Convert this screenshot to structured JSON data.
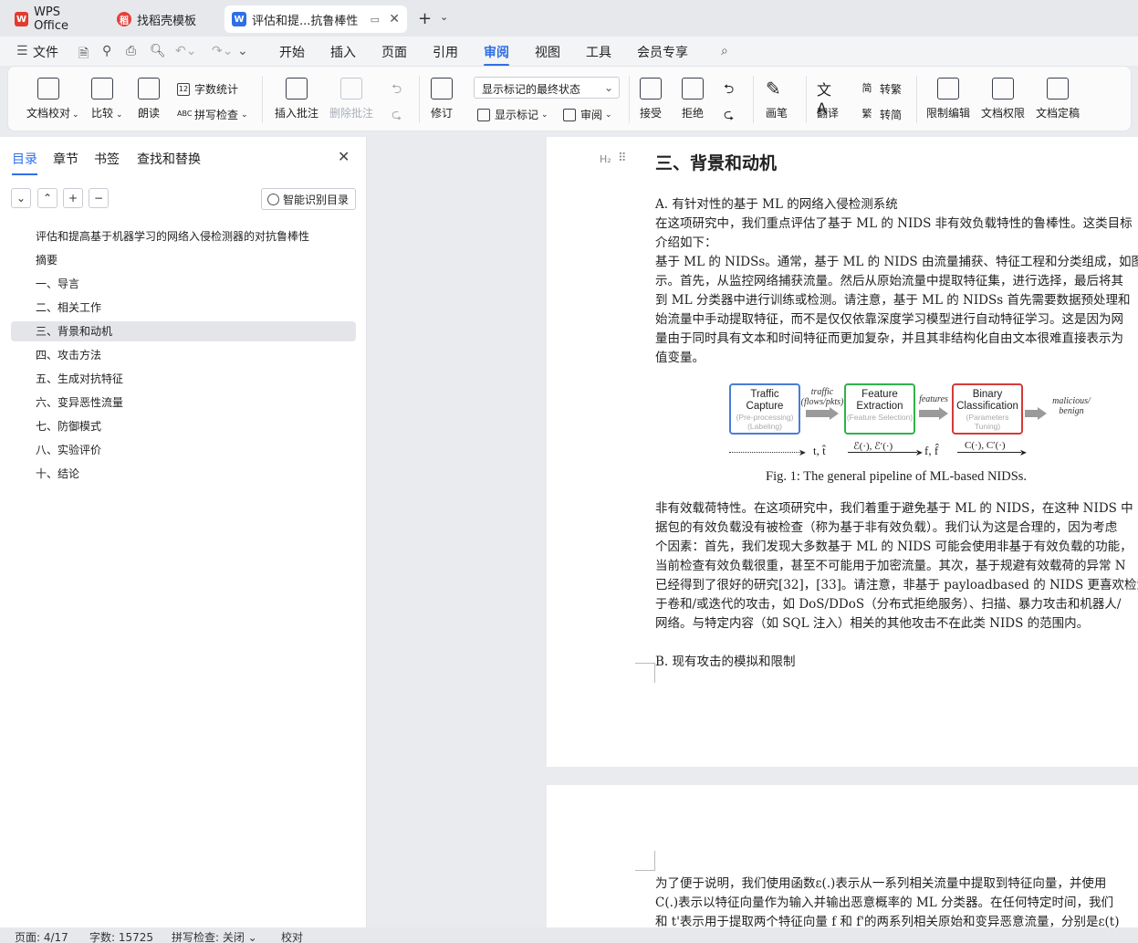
{
  "titlebar": {
    "tabs": [
      {
        "label": "WPS Office",
        "icon": "wps-logo-icon"
      },
      {
        "label": "找稻壳模板",
        "icon": "docer-icon"
      },
      {
        "label": "评估和提...抗鲁棒性",
        "icon": "word-doc-icon"
      }
    ]
  },
  "menubar": {
    "file": "文件",
    "items": [
      "开始",
      "插入",
      "页面",
      "引用",
      "审阅",
      "视图",
      "工具",
      "会员专享"
    ],
    "active": "审阅"
  },
  "ribbon": {
    "proofread": "文档校对",
    "compare": "比较",
    "read_aloud": "朗读",
    "word_count": "字数统计",
    "spell_check": "拼写检查",
    "insert_comment": "插入批注",
    "delete_comment": "删除批注",
    "revise": "修订",
    "markup_state": "显示标记的最终状态",
    "show_markup": "显示标记",
    "review": "审阅",
    "accept": "接受",
    "reject": "拒绝",
    "pen": "画笔",
    "translate": "翻译",
    "to_traditional": "转繁",
    "to_simplified": "转简",
    "restrict_edit": "限制编辑",
    "doc_permission": "文档权限",
    "doc_finalize": "文档定稿"
  },
  "sidebar": {
    "tabs": [
      "目录",
      "章节",
      "书签",
      "查找和替换"
    ],
    "smart_toc": "智能识别目录",
    "toc": [
      "评估和提高基于机器学习的网络入侵检测器的对抗鲁棒性",
      "摘要",
      "一、导言",
      "二、相关工作",
      "三、背景和动机",
      "四、攻击方法",
      "五、生成对抗特征",
      "六、变异恶性流量",
      "七、防御模式",
      "八、实验评价",
      "十、结论"
    ],
    "selected_index": 4
  },
  "document": {
    "heading": "三、背景和动机",
    "subA": "A. 有针对性的基于 ML 的网络入侵检测系统",
    "para1": [
      "在这项研究中，我们重点评估了基于 ML 的 NIDS 非有效负载特性的鲁棒性。这类目标",
      "介绍如下：",
      "基于 ML 的 NIDSs。通常，基于 ML 的 NIDS 由流量捕获、特征工程和分类组成，如图",
      "示。首先，从监控网络捕获流量。然后从原始流量中提取特征集，进行选择，最后将其",
      "到 ML 分类器中进行训练或检测。请注意，基于 ML 的 NIDSs 首先需要数据预处理和",
      "始流量中手动提取特征，而不是仅仅依靠深度学习模型进行自动特征学习。这是因为网",
      "量由于同时具有文本和时间特征而更加复杂，并且其非结构化自由文本很难直接表示为",
      "值变量。"
    ],
    "figure": {
      "box1": {
        "title": "Traffic Capture",
        "sub": "(Pre-processing) (Labeling)"
      },
      "box2": {
        "title": "Feature Extraction",
        "sub": "(Feature Selection)"
      },
      "box3": {
        "title": "Binary Classification",
        "sub": "(Parameters Tuning)"
      },
      "arrow1": "traffic (flows/pkts)",
      "arrow2": "features",
      "arrow3": "malicious/ benign",
      "m1": "t, t̂",
      "m2": "ℰ(·), ℰ′(·)",
      "m3": "f, f̂",
      "m4": "C(·), C′(·)",
      "caption": "Fig. 1: The general pipeline of ML-based NIDSs."
    },
    "para2": [
      "非有效载荷特性。在这项研究中，我们着重于避免基于 ML 的 NIDS，在这种 NIDS 中",
      "据包的有效负载没有被检查（称为基于非有效负载）。我们认为这是合理的，因为考虑",
      "个因素：首先，我们发现大多数基于 ML 的 NIDS 可能会使用非基于有效负载的功能，",
      "当前检查有效负载很重，甚至不可能用于加密流量。其次，基于规避有效载荷的异常 N",
      "已经得到了很好的研究[32]，[33]。请注意，非基于 payloadbased 的 NIDS 更喜欢检测",
      "于卷和/或迭代的攻击，如 DoS/DDoS（分布式拒绝服务）、扫描、暴力攻击和机器人/",
      "网络。与特定内容（如 SQL 注入）相关的其他攻击不在此类 NIDS 的范围内。"
    ],
    "subB": "B. 现有攻击的模拟和限制",
    "page2": [
      "为了便于说明，我们使用函数ε(.)表示从一系列相关流量中提取到特征向量，并使用",
      "C(.)表示以特征向量作为输入并输出恶意概率的 ML 分类器。在任何特定时间，我们",
      "和 t'表示用于提取两个特征向量 f 和 f'的两系列相关原始和变异恶意流量，分别是ε(t)"
    ]
  },
  "statusbar": {
    "page": "页面: 4/17",
    "words": "字数: 15725",
    "spell": "拼写检查: 关闭",
    "proof": "校对"
  },
  "colors": {
    "accent": "#2f6fe6",
    "box_blue": "#4a7cd6",
    "box_green": "#2fb34a",
    "box_red": "#d63a3a"
  }
}
